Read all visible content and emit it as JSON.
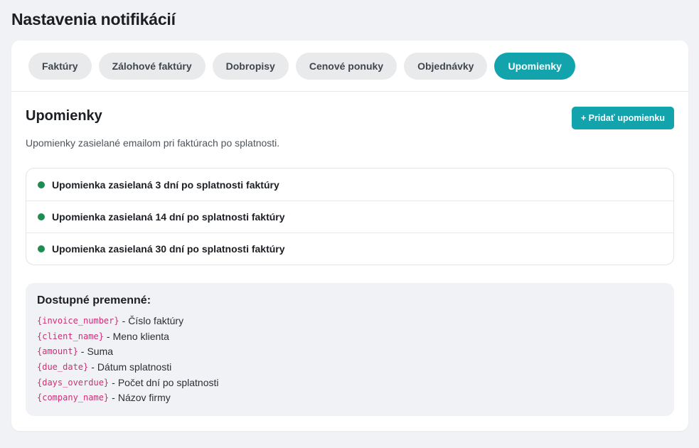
{
  "page": {
    "title": "Nastavenia notifikácií"
  },
  "tabs": [
    {
      "label": "Faktúry",
      "active": false
    },
    {
      "label": "Zálohové faktúry",
      "active": false
    },
    {
      "label": "Dobropisy",
      "active": false
    },
    {
      "label": "Cenové ponuky",
      "active": false
    },
    {
      "label": "Objednávky",
      "active": false
    },
    {
      "label": "Upomienky",
      "active": true
    }
  ],
  "section": {
    "title": "Upomienky",
    "add_button_label": "+ Pridať upomienku",
    "description": "Upomienky zasielané emailom pri faktúrach po splatnosti."
  },
  "reminders": [
    {
      "label": "Upomienka zasielaná 3 dní po splatnosti faktúry",
      "status": "active"
    },
    {
      "label": "Upomienka zasielaná 14 dní po splatnosti faktúry",
      "status": "active"
    },
    {
      "label": "Upomienka zasielaná 30 dní po splatnosti faktúry",
      "status": "active"
    }
  ],
  "variables": {
    "title": "Dostupné premenné:",
    "separator": "-",
    "items": [
      {
        "code": "{invoice_number}",
        "description": "Číslo faktúry"
      },
      {
        "code": "{client_name}",
        "description": "Meno klienta"
      },
      {
        "code": "{amount}",
        "description": "Suma"
      },
      {
        "code": "{due_date}",
        "description": "Dátum splatnosti"
      },
      {
        "code": "{days_overdue}",
        "description": "Počet dní po splatnosti"
      },
      {
        "code": "{company_name}",
        "description": "Názov firmy"
      }
    ]
  },
  "colors": {
    "accent": "#12a3ad",
    "status_active": "#1e8d52",
    "variable_code": "#cc2f77",
    "page_background": "#f1f2f5"
  }
}
